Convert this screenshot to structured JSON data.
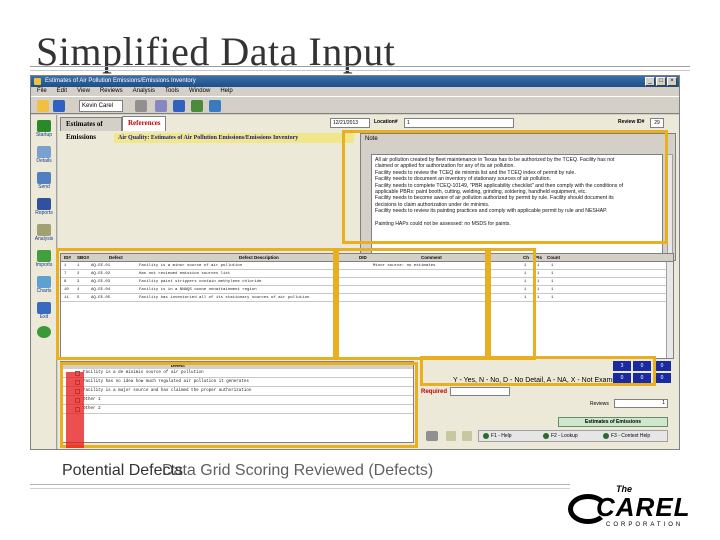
{
  "slide": {
    "title": "Simplified Data Input",
    "bottom_caption": "Potential Defects",
    "caption_overlay": "Data Grid Scoring Reviewed (Defects)"
  },
  "app": {
    "window_title": "Estimates of Air Pollution Emissions/Emissions Inventory",
    "menu": [
      "File",
      "Edit",
      "View",
      "Reviews",
      "Analysis",
      "Tools",
      "Window",
      "Help"
    ],
    "user_name": "Kevin Carel",
    "nav": [
      {
        "label": "Startup",
        "icon": "arrow-icon"
      },
      {
        "label": "Details",
        "icon": "details-icon"
      },
      {
        "label": "Send",
        "icon": "send-icon"
      },
      {
        "label": "Reports",
        "icon": "reports-icon"
      },
      {
        "label": "Analysis",
        "icon": "analysis-icon"
      },
      {
        "label": "Imports",
        "icon": "imports-icon"
      },
      {
        "label": "Charts",
        "icon": "charts-icon"
      },
      {
        "label": "Exit",
        "icon": "exit-icon"
      }
    ],
    "tabs": {
      "estimates": "Estimates of Emissions",
      "references": "References"
    },
    "date_value": "12/21/2013",
    "location_label": "Location#",
    "location_value": "1",
    "review_label": "Review ID#",
    "review_value": "29",
    "section_title": "Air Quality: Estimates of Air Pollution Emissions/Emissions Inventory",
    "note_label": "Note",
    "note_lines": [
      "All air pollution created by fleet maintenance in Texas has to be authorized by the TCEQ. Facility has not",
      "claimed or applied for authorization for any of its air pollution.",
      "Facility needs to review the TCEQ de minimis list and the TCEQ index of permit by rule.",
      "Facility needs to document an inventory of stationary sources of air pollution.",
      "Facility needs to complete TCEQ-10149, \"PBR applicability checklist\" and then comply with the conditions of",
      "applicable PBRs: paint booth, cutting, welding, grinding, soldering, handheld equipment, etc.",
      "Facility needs to become aware of air pollution authorized by permit by rule. Facility should document its",
      "decisions to claim authorization under de minimis.",
      "Facility needs to review its painting practices and comply with applicable permit by rule and NESHAP.",
      "",
      "Painting HAPs could not be assessed: no MSDS for paints."
    ],
    "grid_headers": [
      "ID#",
      "SBG#",
      "Defect",
      "Defect Description",
      "DID",
      "Comment",
      "Ch",
      "Pts",
      "Count"
    ],
    "grid_rows": [
      {
        "id": "1",
        "sbg": "1",
        "defect": "AQ-EE-01",
        "desc": "Facility is a minor source of air pollution",
        "comment": "Minor source: no estimates",
        "ch": "1",
        "pts": "1",
        "count": "1"
      },
      {
        "id": "7",
        "sbg": "2",
        "defect": "AQ-EE-02",
        "desc": "Has not reviewed emission sources list",
        "comment": "",
        "ch": "1",
        "pts": "1",
        "count": "1"
      },
      {
        "id": "8",
        "sbg": "3",
        "defect": "AQ-EE-03",
        "desc": "Facility paint strippers contain methylene chloride",
        "comment": "",
        "ch": "1",
        "pts": "1",
        "count": "1"
      },
      {
        "id": "10",
        "sbg": "4",
        "defect": "AQ-EE-04",
        "desc": "Facility is in a NNAQS ozone nonattainment region",
        "comment": "",
        "ch": "1",
        "pts": "1",
        "count": "1"
      },
      {
        "id": "11",
        "sbg": "5",
        "defect": "AQ-EE-05",
        "desc": "Facility has inventoried all of its stationary sources of air pollution",
        "comment": "",
        "ch": "1",
        "pts": "1",
        "count": "1"
      }
    ],
    "pd_header": "Defect",
    "potential_defects": [
      "Facility is a de minimis source of air pollution",
      "Facility has no idea how much regulated air pollution it generates",
      "Facility is a major source and has claimed the proper authorization",
      "Other 1",
      "Other 2"
    ],
    "yn_legend": "Y - Yes, N - No, D - No Detail, A - NA, X - Not Examined",
    "color_grid": [
      "3",
      "0",
      "0",
      "0",
      "0",
      "0"
    ],
    "required_label": "Required",
    "reviews_label": "Reviews",
    "reviews_value": "1",
    "eot_label": "Estimates of Emissions",
    "fkeys": [
      "F1 - Help",
      "F2 - Lookup",
      "F3 - Context Help"
    ]
  },
  "colors": {
    "highlight": "#e8b020",
    "highlight_red": "#e61e1e",
    "tab_active_text": "#c00000",
    "section_header_bg": "#f0e68c"
  },
  "logo": {
    "the": "The",
    "main": "CAREL",
    "sub": "CORPORATION"
  }
}
